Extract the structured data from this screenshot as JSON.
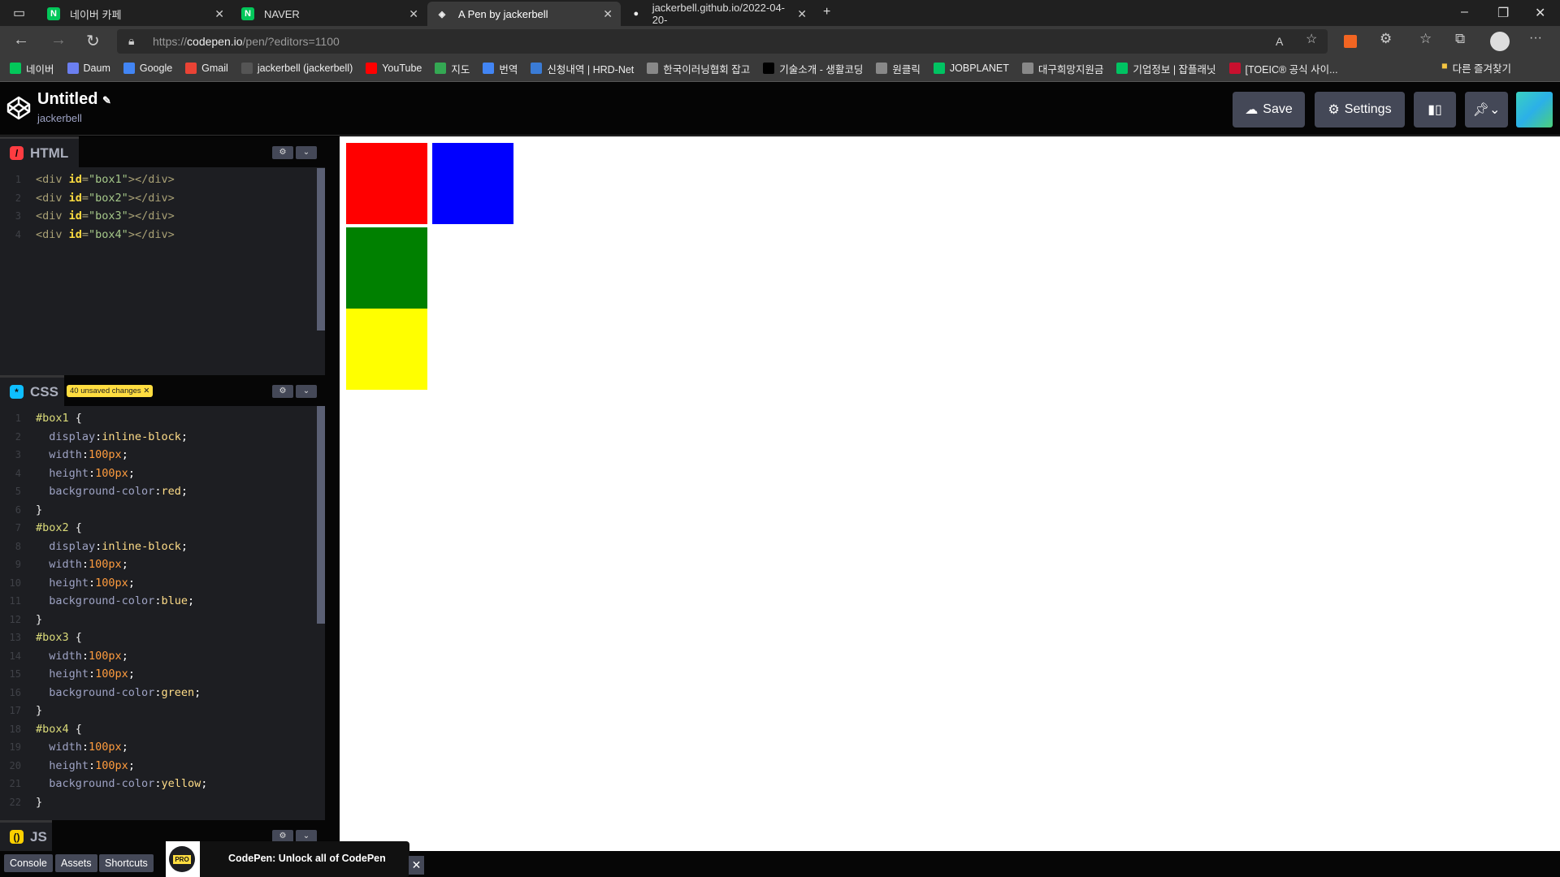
{
  "browser": {
    "tabs": [
      {
        "label": "네이버 카페",
        "icon": "naver-cafe-icon",
        "color": "#03c75a"
      },
      {
        "label": "NAVER",
        "icon": "naver-icon",
        "color": "#03c75a"
      },
      {
        "label": "A Pen by jackerbell",
        "icon": "codepen-icon",
        "color": "#ffffff"
      },
      {
        "label": "jackerbell.github.io/2022-04-20-",
        "icon": "github-icon",
        "color": "#ffffff"
      }
    ],
    "url_scheme": "https://",
    "url_host": "codepen.io",
    "url_path": "/pen/?editors=1100",
    "bookmarks": [
      {
        "label": "네이버",
        "color": "#03c75a"
      },
      {
        "label": "Daum",
        "color": "#6b7ff0"
      },
      {
        "label": "Google",
        "color": "#4285f4"
      },
      {
        "label": "Gmail",
        "color": "#ea4335"
      },
      {
        "label": "jackerbell (jackerbell)",
        "color": "#555"
      },
      {
        "label": "YouTube",
        "color": "#ff0000"
      },
      {
        "label": "지도",
        "color": "#34a853"
      },
      {
        "label": "번역",
        "color": "#4285f4"
      },
      {
        "label": "신청내역 | HRD-Net",
        "color": "#3a7bd5"
      },
      {
        "label": "한국이러닝협회 잡고",
        "color": "#888"
      },
      {
        "label": "기술소개 - 생활코딩",
        "color": "#000"
      },
      {
        "label": "원클릭",
        "color": "#888"
      },
      {
        "label": "JOBPLANET",
        "color": "#00c362"
      },
      {
        "label": "대구희망지원금",
        "color": "#888"
      },
      {
        "label": "기업정보 | 잡플래닛",
        "color": "#00c362"
      },
      {
        "label": "[TOEIC® 공식 사이...",
        "color": "#c8102e"
      }
    ],
    "other_bookmarks": "다른 즐겨찾기"
  },
  "codepen": {
    "title": "Untitled",
    "owner": "jackerbell",
    "save": "Save",
    "settings": "Settings",
    "html_label": "HTML",
    "css_label": "CSS",
    "js_label": "JS",
    "unsaved_badge": "40 unsaved changes",
    "console": "Console",
    "assets": "Assets",
    "shortcuts": "Shortcuts",
    "promo_badge": "PRO",
    "promo_text": "CodePen: Unlock all of CodePen"
  },
  "html_code": [
    [
      [
        "<div ",
        "tag"
      ],
      [
        "id",
        "attr"
      ],
      [
        "=",
        "tag"
      ],
      [
        "\"box1\"",
        "str"
      ],
      [
        "></div>",
        "tag"
      ]
    ],
    [
      [
        "<div ",
        "tag"
      ],
      [
        "id",
        "attr"
      ],
      [
        "=",
        "tag"
      ],
      [
        "\"box2\"",
        "str"
      ],
      [
        "></div>",
        "tag"
      ]
    ],
    [
      [
        "<div ",
        "tag"
      ],
      [
        "id",
        "attr"
      ],
      [
        "=",
        "tag"
      ],
      [
        "\"box3\"",
        "str"
      ],
      [
        "></div>",
        "tag"
      ]
    ],
    [
      [
        "<div ",
        "tag"
      ],
      [
        "id",
        "attr"
      ],
      [
        "=",
        "tag"
      ],
      [
        "\"box4\"",
        "str"
      ],
      [
        "></div>",
        "tag"
      ]
    ]
  ],
  "css_code": [
    [
      [
        "#box1 ",
        "sel"
      ],
      [
        "{",
        "brc"
      ]
    ],
    [
      [
        "  display",
        "prop"
      ],
      [
        ":",
        "pun"
      ],
      [
        "inline-block",
        "val"
      ],
      [
        ";",
        "pun"
      ]
    ],
    [
      [
        "  width",
        "prop"
      ],
      [
        ":",
        "pun"
      ],
      [
        "100px",
        "num"
      ],
      [
        ";",
        "pun"
      ]
    ],
    [
      [
        "  height",
        "prop"
      ],
      [
        ":",
        "pun"
      ],
      [
        "100px",
        "num"
      ],
      [
        ";",
        "pun"
      ]
    ],
    [
      [
        "  background-color",
        "prop"
      ],
      [
        ":",
        "pun"
      ],
      [
        "red",
        "val"
      ],
      [
        ";",
        "pun"
      ]
    ],
    [
      [
        "}",
        "brc"
      ]
    ],
    [
      [
        "#box2 ",
        "sel"
      ],
      [
        "{",
        "brc"
      ]
    ],
    [
      [
        "  display",
        "prop"
      ],
      [
        ":",
        "pun"
      ],
      [
        "inline-block",
        "val"
      ],
      [
        ";",
        "pun"
      ]
    ],
    [
      [
        "  width",
        "prop"
      ],
      [
        ":",
        "pun"
      ],
      [
        "100px",
        "num"
      ],
      [
        ";",
        "pun"
      ]
    ],
    [
      [
        "  height",
        "prop"
      ],
      [
        ":",
        "pun"
      ],
      [
        "100px",
        "num"
      ],
      [
        ";",
        "pun"
      ]
    ],
    [
      [
        "  background-color",
        "prop"
      ],
      [
        ":",
        "pun"
      ],
      [
        "blue",
        "val"
      ],
      [
        ";",
        "pun"
      ]
    ],
    [
      [
        "}",
        "brc"
      ]
    ],
    [
      [
        "#box3 ",
        "sel"
      ],
      [
        "{",
        "brc"
      ]
    ],
    [
      [
        "  width",
        "prop"
      ],
      [
        ":",
        "pun"
      ],
      [
        "100px",
        "num"
      ],
      [
        ";",
        "pun"
      ]
    ],
    [
      [
        "  height",
        "prop"
      ],
      [
        ":",
        "pun"
      ],
      [
        "100px",
        "num"
      ],
      [
        ";",
        "pun"
      ]
    ],
    [
      [
        "  background-color",
        "prop"
      ],
      [
        ":",
        "pun"
      ],
      [
        "green",
        "val"
      ],
      [
        ";",
        "pun"
      ]
    ],
    [
      [
        "}",
        "brc"
      ]
    ],
    [
      [
        "#box4 ",
        "sel"
      ],
      [
        "{",
        "brc"
      ]
    ],
    [
      [
        "  width",
        "prop"
      ],
      [
        ":",
        "pun"
      ],
      [
        "100px",
        "num"
      ],
      [
        ";",
        "pun"
      ]
    ],
    [
      [
        "  height",
        "prop"
      ],
      [
        ":",
        "pun"
      ],
      [
        "100px",
        "num"
      ],
      [
        ";",
        "pun"
      ]
    ],
    [
      [
        "  background-color",
        "prop"
      ],
      [
        ":",
        "pun"
      ],
      [
        "yellow",
        "val"
      ],
      [
        ";",
        "pun"
      ]
    ],
    [
      [
        "}",
        "brc"
      ]
    ]
  ],
  "preview_boxes": [
    {
      "id": "box1",
      "color": "#ff0000"
    },
    {
      "id": "box2",
      "color": "#0000ff"
    },
    {
      "id": "box3",
      "color": "#008000"
    },
    {
      "id": "box4",
      "color": "#ffff00"
    }
  ]
}
